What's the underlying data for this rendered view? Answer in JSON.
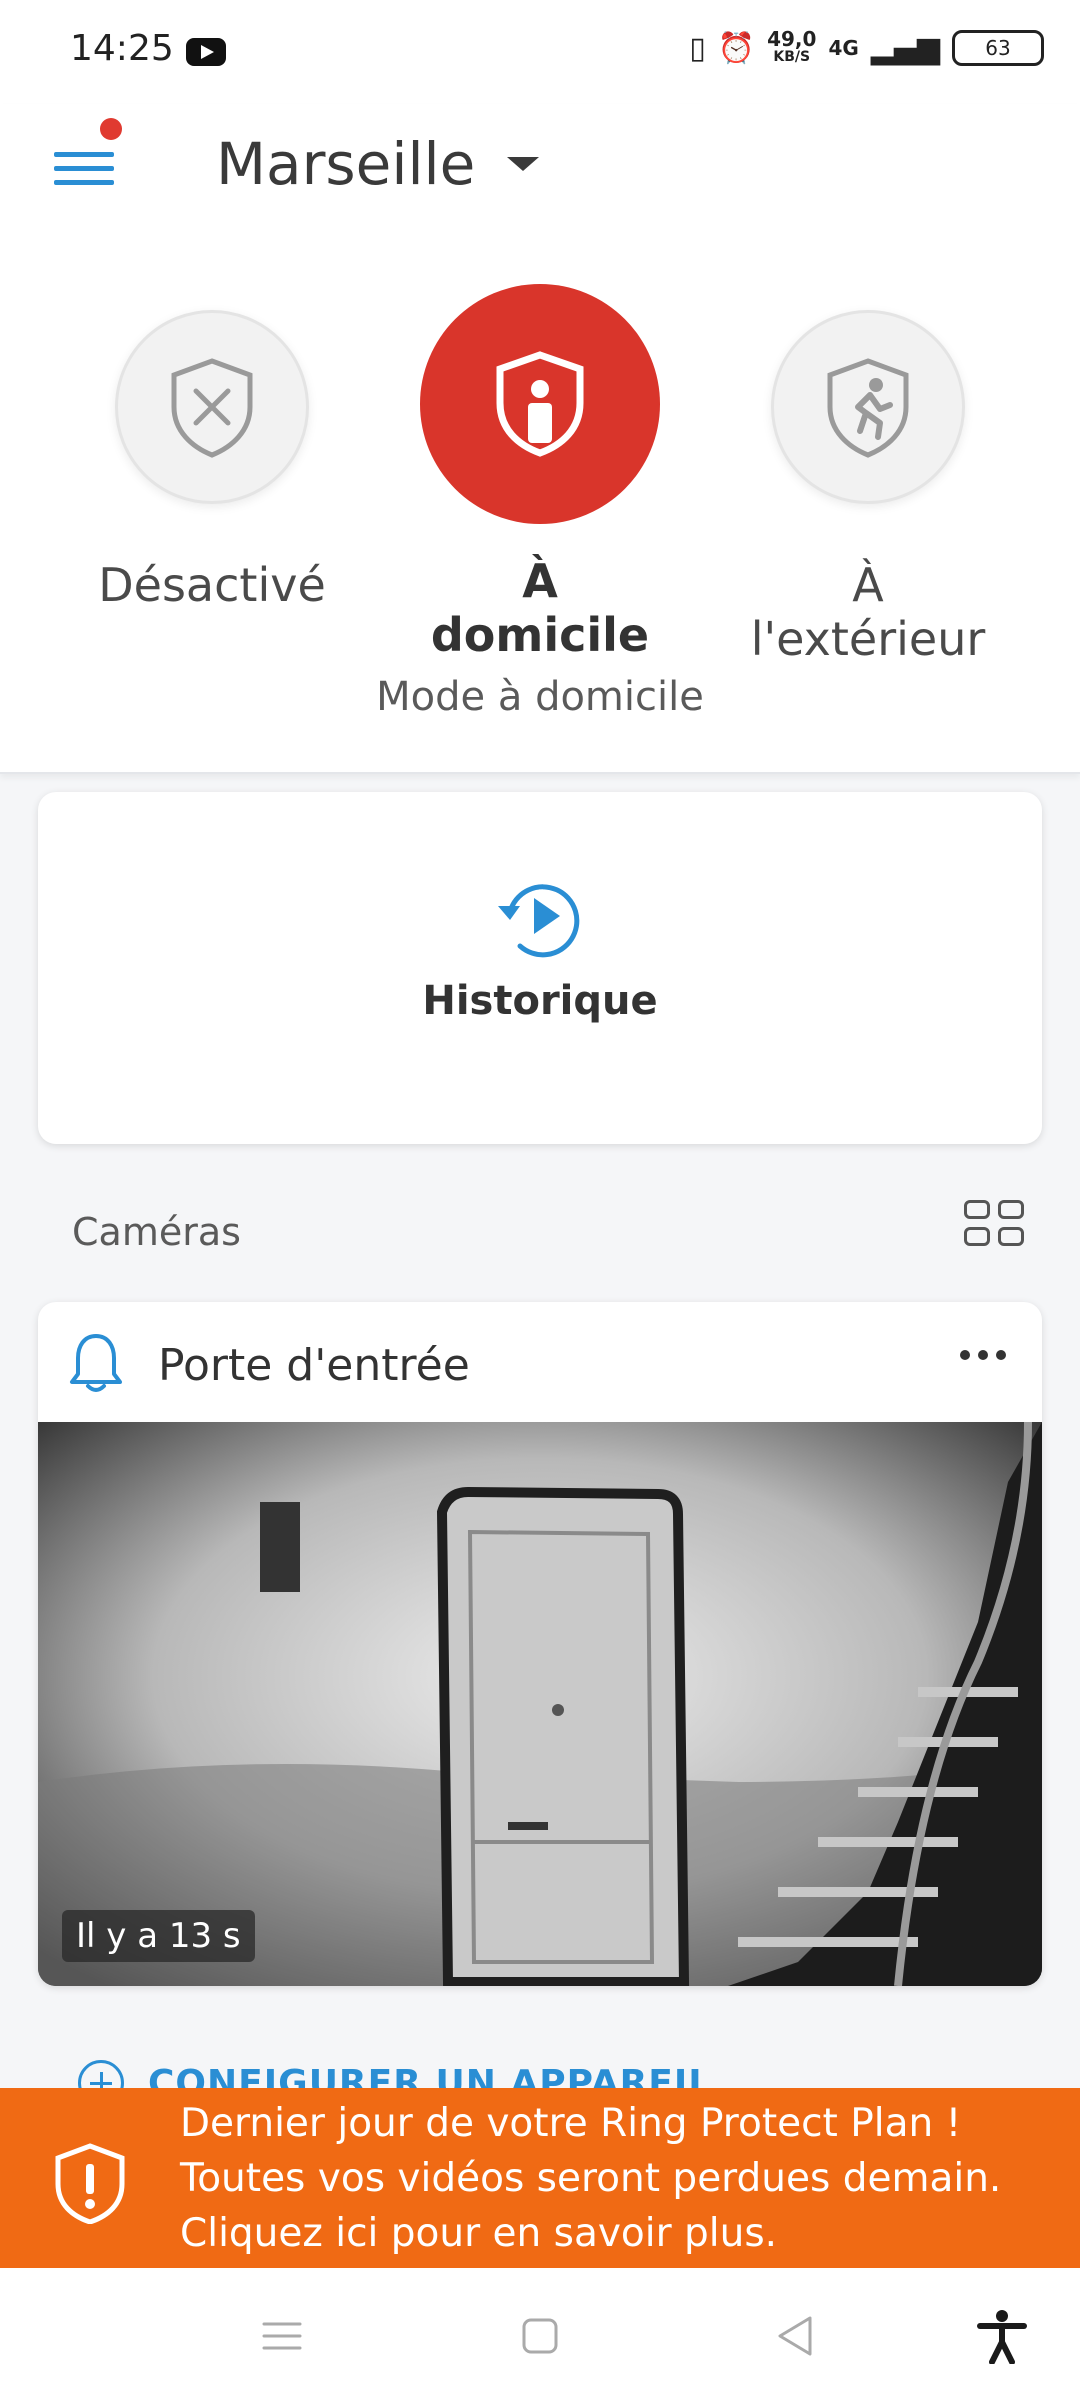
{
  "status_bar": {
    "time": "14:25",
    "speed_value": "49,0",
    "speed_unit": "KB/S",
    "network": "4G",
    "battery": "63"
  },
  "header": {
    "location": "Marseille",
    "modes": [
      {
        "label": "Désactivé",
        "icon": "shield-x-icon"
      },
      {
        "label": "À domicile",
        "icon": "shield-person-icon"
      },
      {
        "label": "À l'extérieur",
        "icon": "shield-running-icon"
      }
    ],
    "mode_status": "Mode à domicile"
  },
  "history": {
    "label": "Historique"
  },
  "cameras": {
    "title": "Caméras",
    "items": [
      {
        "name": "Porte d'entrée",
        "time_ago": "Il y a 13 s"
      }
    ]
  },
  "setup": {
    "label": "CONFIGURER UN APPAREIL"
  },
  "banner": {
    "line1": "Dernier jour de votre Ring Protect Plan !",
    "line2": "Toutes vos vidéos seront perdues demain.",
    "line3": "Cliquez ici pour en savoir plus."
  },
  "colors": {
    "accent": "#2a8ed4",
    "active_mode": "#d9352b",
    "banner": "#f06a14",
    "notification_dot": "#e03a30"
  }
}
